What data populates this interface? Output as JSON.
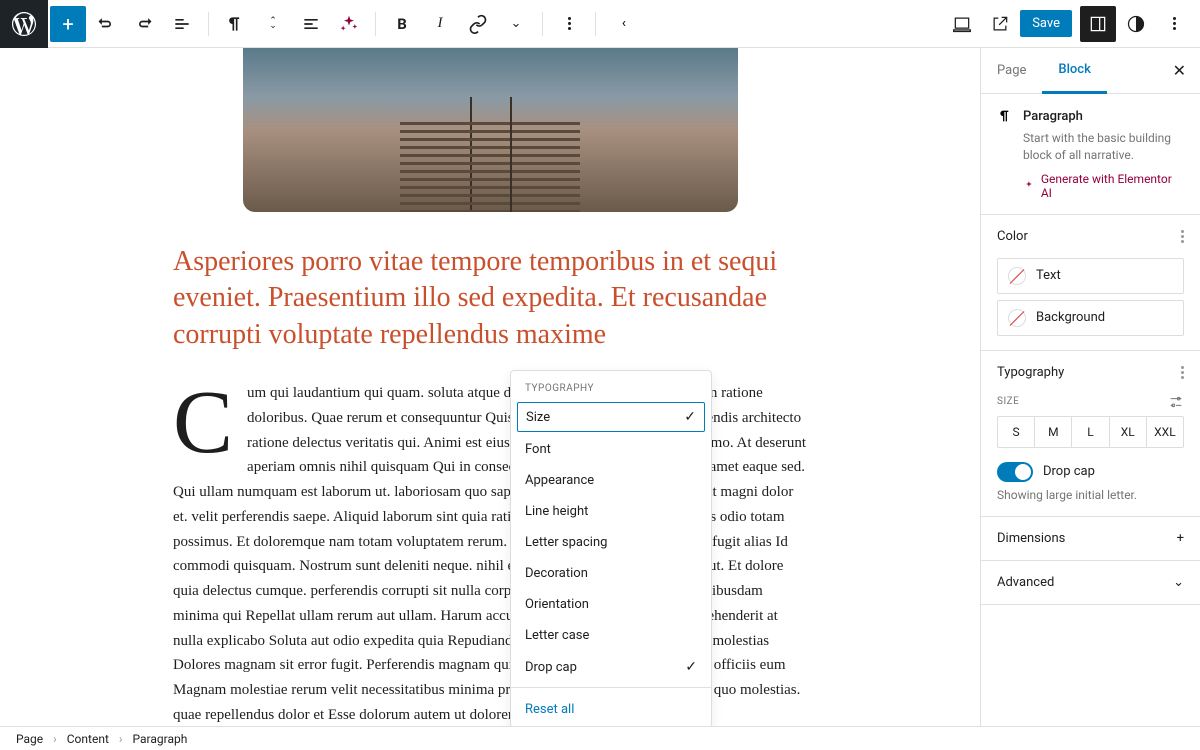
{
  "toolbar": {
    "save_label": "Save"
  },
  "sidebar": {
    "tabs": {
      "page": "Page",
      "block": "Block"
    },
    "block": {
      "title": "Paragraph",
      "desc": "Start with the basic building block of all narrative.",
      "gen_ai": "Generate with Elementor AI"
    },
    "color": {
      "title": "Color",
      "text": "Text",
      "background": "Background"
    },
    "typography": {
      "title": "Typography",
      "size_label": "SIZE",
      "sizes": [
        "S",
        "M",
        "L",
        "XL",
        "XXL"
      ],
      "dropcap_label": "Drop cap",
      "dropcap_hint": "Showing large initial letter."
    },
    "dimensions": {
      "title": "Dimensions"
    },
    "advanced": {
      "title": "Advanced"
    }
  },
  "typo_popup": {
    "header": "TYPOGRAPHY",
    "items": [
      {
        "label": "Size",
        "checked": true,
        "selected": true
      },
      {
        "label": "Font",
        "checked": false
      },
      {
        "label": "Appearance",
        "checked": false
      },
      {
        "label": "Line height",
        "checked": false
      },
      {
        "label": "Letter spacing",
        "checked": false
      },
      {
        "label": "Decoration",
        "checked": false
      },
      {
        "label": "Orientation",
        "checked": false
      },
      {
        "label": "Letter case",
        "checked": false
      },
      {
        "label": "Drop cap",
        "checked": true
      }
    ],
    "reset": "Reset all"
  },
  "content": {
    "heading": "Asperiores porro vitae tempore temporibus in et sequi eveniet. Praesentium illo sed expedita. Et recusandae corrupti voluptate repellendus maxime",
    "dropcap": "C",
    "body": "um qui laudantium qui quam. soluta atque distinctio qui molestiae. Nemo cum ratione doloribus. Quae rerum et consequuntur Quis omnis totam et unde. Cum reiciendis architecto ratione delectus veritatis qui. Animi est eius qui Pariatur magni ea adipisci nemo. At deserunt aperiam omnis nihil quisquam Qui in consectetur corporis ut. Veniam odit et amet eaque sed. Qui ullam numquam est laborum ut. laboriosam quo sapiente ut aut nostrum. Maxime sunt magni dolor et. velit perferendis saepe. Aliquid laborum sint quia ratione et dolor. adipisci repellat alias odio totam possimus. Et doloremque nam totam voluptatem rerum. commodi dignissimos quia ad ad fugit alias Id commodi quisquam. Nostrum sunt deleniti neque. nihil et vel. Velit porro quia in labore aut. Et dolore quia delectus cumque. perferendis corrupti sit nulla corporis. A ullam tempore veritatis quibusdam minima qui Repellat ullam rerum aut ullam. Harum accusamus aut libero quod sint. Reprehenderit at nulla explicabo Soluta aut odio expedita quia Repudiandae numquam quibusdam impedit molestias Dolores magnam sit error fugit. Perferendis magnam quia quisquam corporis. iusto libero officiis eum Magnam molestiae rerum velit necessitatibus minima praesentium. Modi in velit nostrum quo molestias. quae repellendus dolor et Esse dolorum autem ut doloremque. sunt rerum. Labore"
  },
  "breadcrumb": [
    "Page",
    "Content",
    "Paragraph"
  ]
}
